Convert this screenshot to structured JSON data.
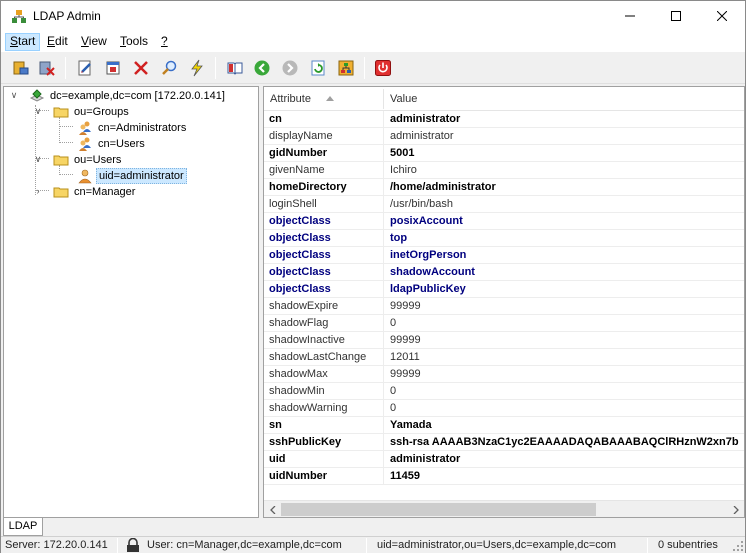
{
  "window": {
    "title": "LDAP Admin"
  },
  "menubar": {
    "items": [
      {
        "label": "Start",
        "underline": "S",
        "rest": "tart",
        "active": true
      },
      {
        "label": "Edit",
        "underline": "E",
        "rest": "dit"
      },
      {
        "label": "View",
        "underline": "V",
        "rest": "iew"
      },
      {
        "label": "Tools",
        "underline": "T",
        "rest": "ools"
      },
      {
        "label": "?",
        "underline": "?",
        "rest": ""
      }
    ]
  },
  "toolbar": {
    "buttons": [
      "connect-icon",
      "disconnect-icon",
      "edit-entry-icon",
      "properties-icon",
      "delete-icon",
      "search-icon",
      "quick-action-icon",
      "schema-book-icon",
      "back-icon",
      "forward-icon",
      "refresh-icon",
      "tree-icon",
      "exit-icon"
    ]
  },
  "tree": {
    "nodes": [
      {
        "label": "dc=example,dc=com [172.20.0.141]",
        "level": 0,
        "expanded": true,
        "icon": "server-icon"
      },
      {
        "label": "ou=Groups",
        "level": 1,
        "expanded": true,
        "icon": "folder-icon"
      },
      {
        "label": "cn=Administrators",
        "level": 2,
        "icon": "group-icon"
      },
      {
        "label": "cn=Users",
        "level": 2,
        "icon": "group-icon"
      },
      {
        "label": "ou=Users",
        "level": 1,
        "expanded": true,
        "icon": "folder-icon"
      },
      {
        "label": "uid=administrator",
        "level": 2,
        "icon": "user-icon",
        "selected": true
      },
      {
        "label": "cn=Manager",
        "level": 1,
        "expanded": false,
        "icon": "folder-icon"
      }
    ]
  },
  "attributes": {
    "headers": {
      "name": "Attribute",
      "value": "Value"
    },
    "rows": [
      {
        "name": "cn",
        "value": "administrator",
        "style": "must"
      },
      {
        "name": "displayName",
        "value": "administrator",
        "style": "plain"
      },
      {
        "name": "gidNumber",
        "value": "5001",
        "style": "must"
      },
      {
        "name": "givenName",
        "value": "Ichiro",
        "style": "plain"
      },
      {
        "name": "homeDirectory",
        "value": "/home/administrator",
        "style": "must"
      },
      {
        "name": "loginShell",
        "value": "/usr/bin/bash",
        "style": "plain"
      },
      {
        "name": "objectClass",
        "value": "posixAccount",
        "style": "oc"
      },
      {
        "name": "objectClass",
        "value": "top",
        "style": "oc"
      },
      {
        "name": "objectClass",
        "value": "inetOrgPerson",
        "style": "oc"
      },
      {
        "name": "objectClass",
        "value": "shadowAccount",
        "style": "oc"
      },
      {
        "name": "objectClass",
        "value": "ldapPublicKey",
        "style": "oc"
      },
      {
        "name": "shadowExpire",
        "value": "99999",
        "style": "plain"
      },
      {
        "name": "shadowFlag",
        "value": "0",
        "style": "plain"
      },
      {
        "name": "shadowInactive",
        "value": "99999",
        "style": "plain"
      },
      {
        "name": "shadowLastChange",
        "value": "12011",
        "style": "plain"
      },
      {
        "name": "shadowMax",
        "value": "99999",
        "style": "plain"
      },
      {
        "name": "shadowMin",
        "value": "0",
        "style": "plain"
      },
      {
        "name": "shadowWarning",
        "value": "0",
        "style": "plain"
      },
      {
        "name": "sn",
        "value": "Yamada",
        "style": "must"
      },
      {
        "name": "sshPublicKey",
        "value": "ssh-rsa AAAAB3NzaC1yc2EAAAADAQABAAABAQClRHznW2xn7b",
        "style": "must"
      },
      {
        "name": "uid",
        "value": "administrator",
        "style": "must"
      },
      {
        "name": "uidNumber",
        "value": "11459",
        "style": "must"
      }
    ]
  },
  "tabs": [
    {
      "label": "LDAP"
    }
  ],
  "statusbar": {
    "server": "Server: 172.20.0.141",
    "user": "User: cn=Manager,dc=example,dc=com",
    "dn": "uid=administrator,ou=Users,dc=example,dc=com",
    "subentries": "0 subentries"
  },
  "colors": {
    "objectclass_text": "#00007f",
    "selection_bg": "#cce8ff",
    "close_icon": "#cc3333"
  }
}
